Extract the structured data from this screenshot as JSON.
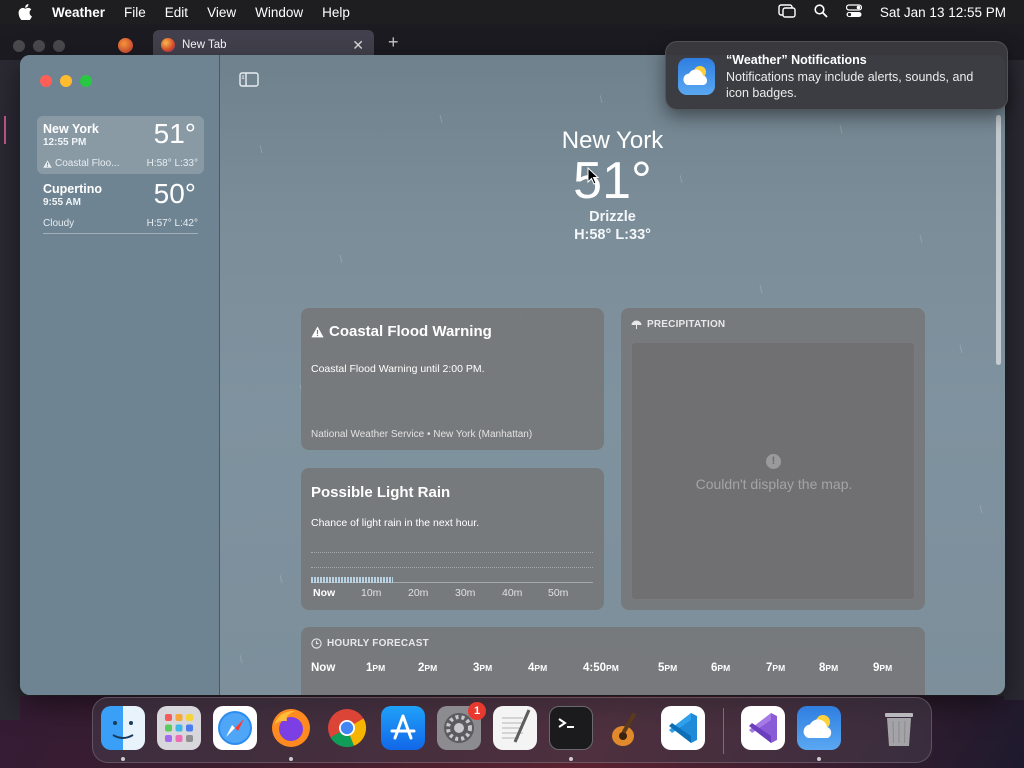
{
  "menubar": {
    "app_name": "Weather",
    "items": [
      "File",
      "Edit",
      "View",
      "Window",
      "Help"
    ],
    "clock": "Sat Jan 13  12:55 PM"
  },
  "browser": {
    "tab_title": "New Tab"
  },
  "sidebar": {
    "cities": [
      {
        "name": "New York",
        "time": "12:55 PM",
        "temp": "51°",
        "condition": "Coastal Floo...",
        "hl": "H:58°  L:33°"
      },
      {
        "name": "Cupertino",
        "time": "9:55 AM",
        "temp": "50°",
        "condition": "Cloudy",
        "hl": "H:57°  L:42°"
      }
    ]
  },
  "hero": {
    "location": "New York",
    "temp": "51°",
    "condition": "Drizzle",
    "hl": "H:58°  L:33°"
  },
  "alert": {
    "title": "Coastal Flood Warning",
    "text": "Coastal Flood Warning until 2:00 PM.",
    "source": "National Weather Service • New York (Manhattan)"
  },
  "rain": {
    "title": "Possible Light Rain",
    "text": "Chance of light rain in the next hour.",
    "ticks": [
      "Now",
      "10m",
      "20m",
      "30m",
      "40m",
      "50m"
    ]
  },
  "precip": {
    "header": "PRECIPITATION",
    "message": "Couldn't display the map."
  },
  "hourly": {
    "header": "HOURLY FORECAST",
    "hours": [
      {
        "num": "Now",
        "ampm": ""
      },
      {
        "num": "1",
        "ampm": "PM"
      },
      {
        "num": "2",
        "ampm": "PM"
      },
      {
        "num": "3",
        "ampm": "PM"
      },
      {
        "num": "4",
        "ampm": "PM"
      },
      {
        "num": "4:50",
        "ampm": "PM"
      },
      {
        "num": "5",
        "ampm": "PM"
      },
      {
        "num": "6",
        "ampm": "PM"
      },
      {
        "num": "7",
        "ampm": "PM"
      },
      {
        "num": "8",
        "ampm": "PM"
      },
      {
        "num": "9",
        "ampm": "PM"
      }
    ]
  },
  "notification": {
    "title": "“Weather” Notifications",
    "body": "Notifications may include alerts, sounds, and icon badges."
  },
  "dock": {
    "apps": [
      "finder-icon",
      "launchpad-icon",
      "safari-icon",
      "firefox-icon",
      "chrome-icon",
      "app-store-icon",
      "system-settings-icon",
      "textedit-icon",
      "terminal-icon",
      "garageband-icon",
      "vscode-icon",
      "visual-studio-icon",
      "weather-icon",
      "trash-icon"
    ],
    "settings_badge": "1"
  },
  "colors": {
    "accent": "#3a86e8",
    "badge": "#e8392e"
  }
}
